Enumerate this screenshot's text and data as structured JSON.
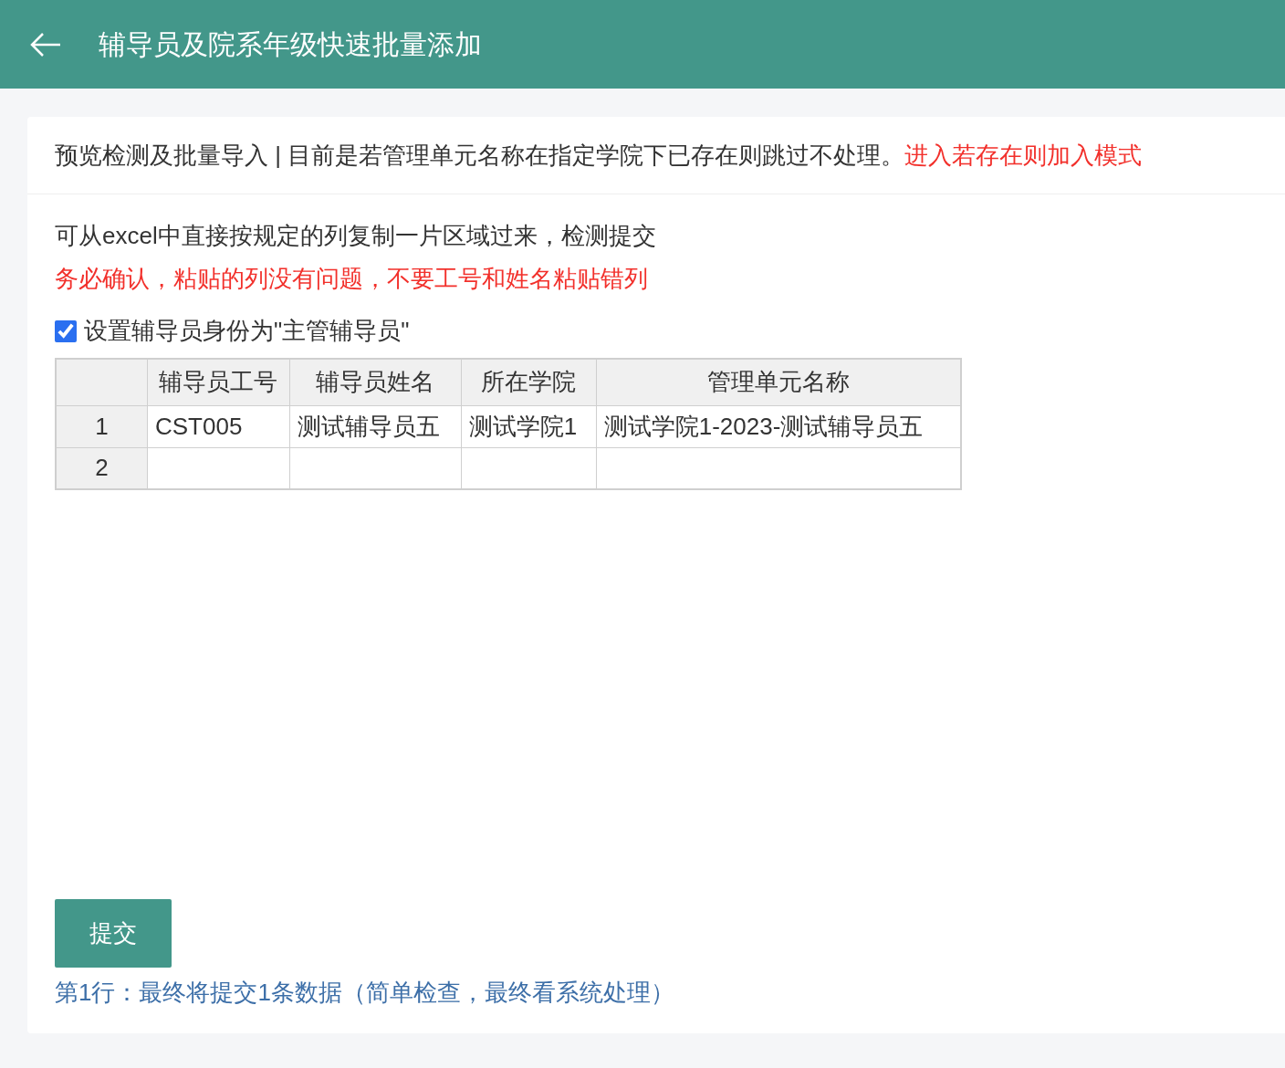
{
  "header": {
    "title": "辅导员及院系年级快速批量添加"
  },
  "notice": {
    "text": "预览检测及批量导入 | 目前是若管理单元名称在指定学院下已存在则跳过不处理。",
    "link": "进入若存在则加入模式"
  },
  "instruction": "可从excel中直接按规定的列复制一片区域过来，检测提交",
  "warning": "务必确认，粘贴的列没有问题，不要工号和姓名粘贴错列",
  "option": {
    "label": "设置辅导员身份为\"主管辅导员\"",
    "checked": true
  },
  "table": {
    "columns": [
      "辅导员工号",
      "辅导员姓名",
      "所在学院",
      "管理单元名称"
    ],
    "rows": [
      {
        "number": "1",
        "cells": [
          "CST005",
          "测试辅导员五",
          "测试学院1",
          "测试学院1-2023-测试辅导员五"
        ]
      },
      {
        "number": "2",
        "cells": []
      }
    ]
  },
  "submit_button": "提交",
  "status": "第1行：最终将提交1条数据（简单检查，最终看系统处理）"
}
